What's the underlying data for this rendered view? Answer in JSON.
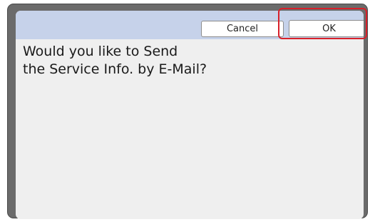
{
  "dialog": {
    "message_lines": [
      "Would you like to Send",
      "the Service Info. by E-Mail?"
    ],
    "buttons": {
      "cancel_label": "Cancel",
      "ok_label": "OK"
    },
    "highlighted_button": "ok"
  },
  "colors": {
    "title_bar": "#c6d2ea",
    "highlight": "#d8202a",
    "frame": "#6b6b6b"
  }
}
